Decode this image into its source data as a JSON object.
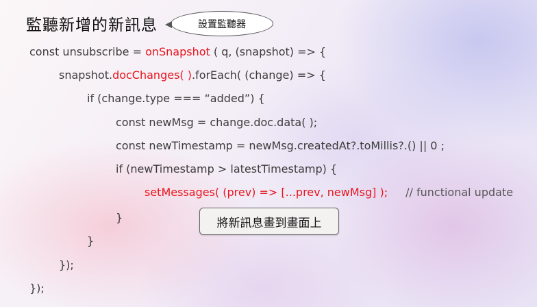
{
  "title": "監聽新增的新訊息",
  "bubble_label": "設置監聽器",
  "box_label": "將新訊息畫到畫面上",
  "code": {
    "l1": {
      "a": "const unsubscribe = ",
      "b": "onSnapshot",
      "c": " ( q, (snapshot) => {"
    },
    "l2": {
      "a": "snapshot.",
      "b": "docChanges( )",
      "c": ".forEach( (change) => {"
    },
    "l3": "if (change.type === “added”) {",
    "l4": "const newMsg = change.doc.data( );",
    "l5": "const newTimestamp = newMsg.createdAt?.toMillis?.() || 0 ;",
    "l6": "if (newTimestamp > latestTimestamp) {",
    "l7": {
      "code": "setMessages( (prev) => [...prev, newMsg] );",
      "comment": "// functional update"
    },
    "l8": "}",
    "l9": "}",
    "l10": "});",
    "l11": "});"
  },
  "colors": {
    "highlight": "#e8141b",
    "text": "#3b3b3b"
  }
}
